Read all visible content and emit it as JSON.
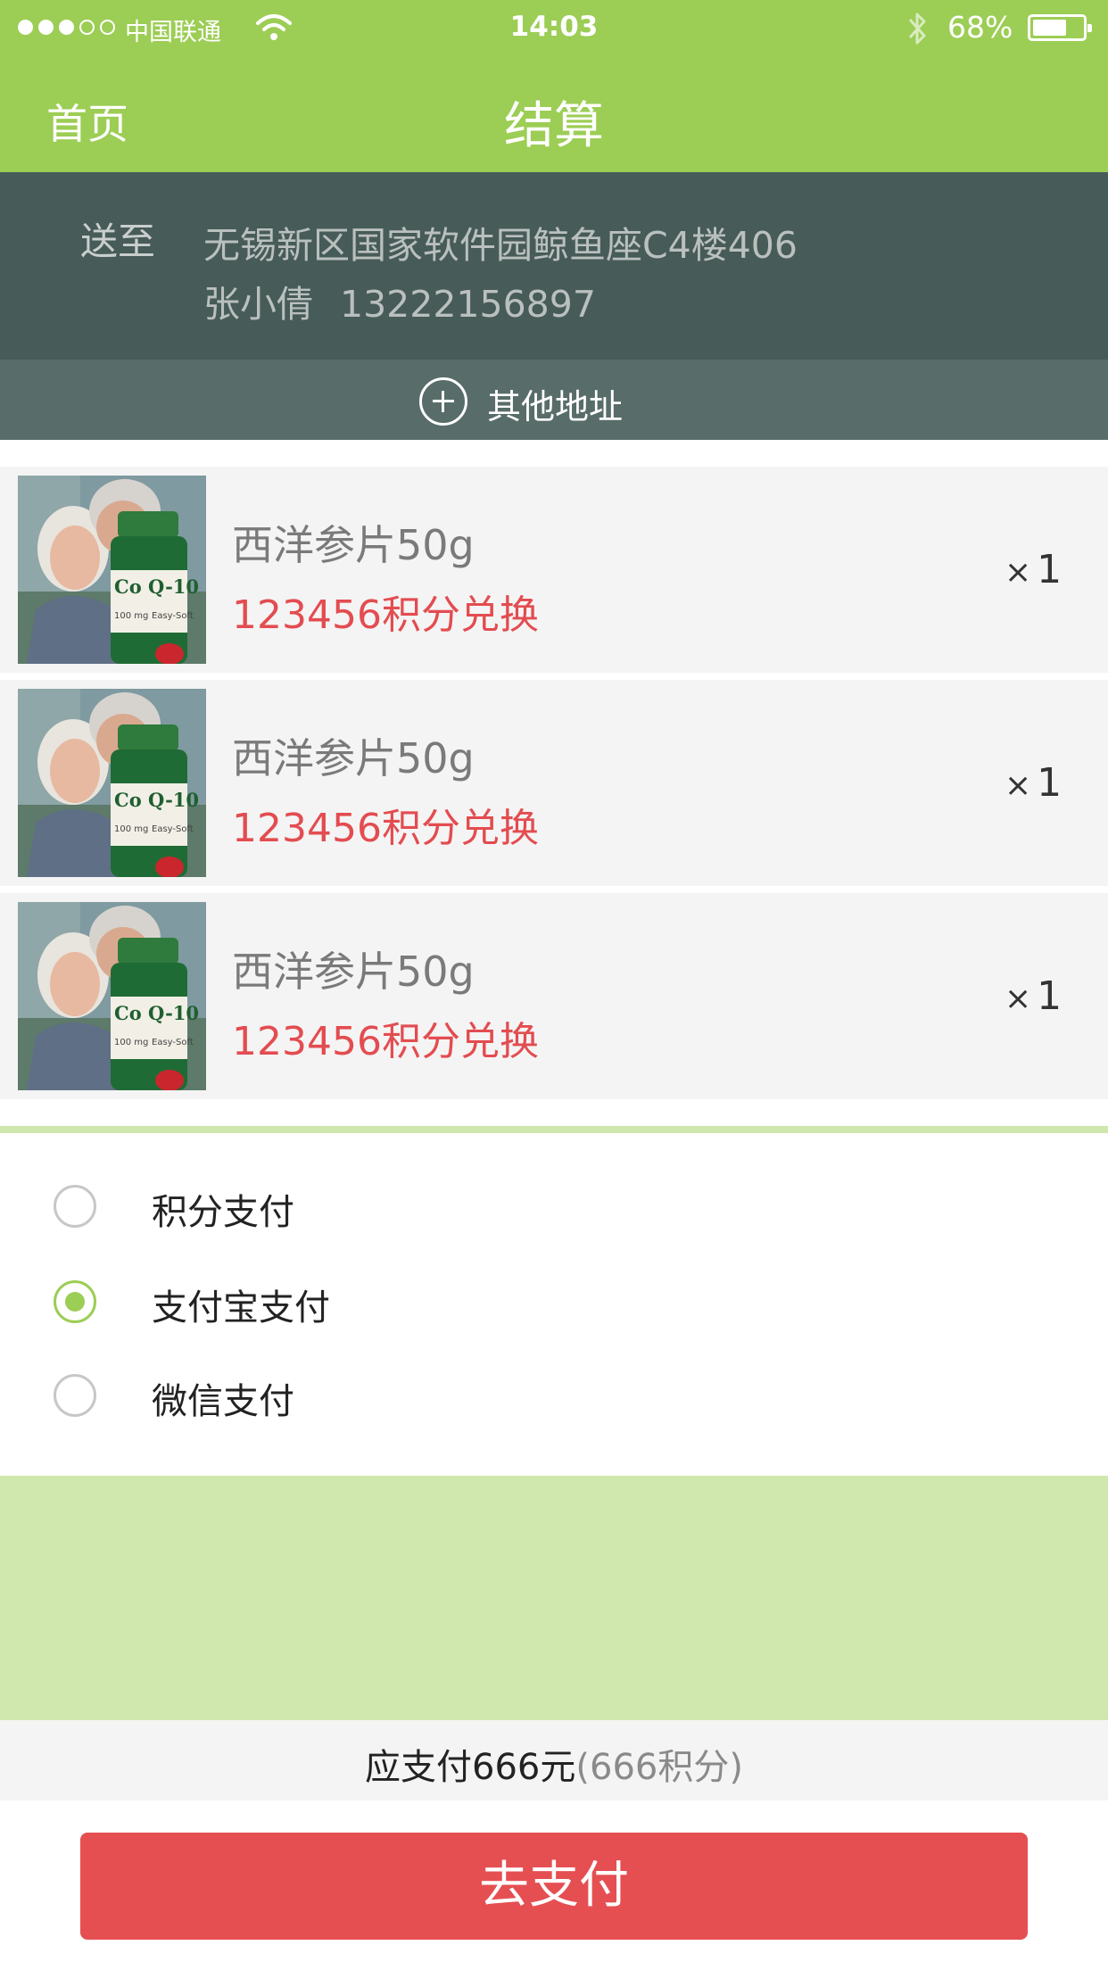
{
  "status_bar": {
    "carrier": "中国联通",
    "time": "14:03",
    "battery_percent": "68%",
    "signal_strength_filled": 3,
    "signal_strength_total": 5,
    "battery_level": 0.68
  },
  "nav": {
    "back_label": "首页",
    "title": "结算"
  },
  "address": {
    "label": "送至",
    "line": "无锡新区国家软件园鲸鱼座C4楼406",
    "name": "张小倩",
    "phone": "13222156897",
    "other_label": "其他地址"
  },
  "items": [
    {
      "name": "西洋参片50g",
      "points": "123456积分兑换",
      "qty_symbol": "×",
      "qty": "1"
    },
    {
      "name": "西洋参片50g",
      "points": "123456积分兑换",
      "qty_symbol": "×",
      "qty": "1"
    },
    {
      "name": "西洋参片50g",
      "points": "123456积分兑换",
      "qty_symbol": "×",
      "qty": "1"
    }
  ],
  "payment": {
    "options": [
      {
        "label": "积分支付",
        "selected": false
      },
      {
        "label": "支付宝支付",
        "selected": true
      },
      {
        "label": "微信支付",
        "selected": false
      }
    ]
  },
  "summary": {
    "main": "应支付666元",
    "sub": "(666积分)"
  },
  "pay_button_label": "去支付",
  "colors": {
    "accent_green": "#9ccd55",
    "light_green": "#d0e8ad",
    "address_bg": "#475b58",
    "points_red": "#e34c50",
    "button_red": "#e54f52"
  },
  "product_image_text": {
    "product": "Co Q-10",
    "dose": "100 mg",
    "form": "Easy-Soft"
  }
}
